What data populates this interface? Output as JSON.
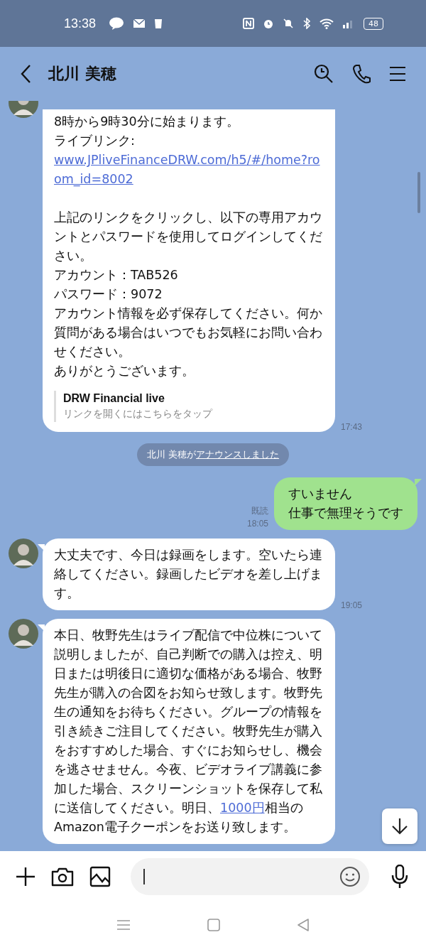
{
  "status_bar": {
    "time": "13:38",
    "battery": "48"
  },
  "header": {
    "title": "北川 美穂"
  },
  "messages": [
    {
      "kind": "incoming",
      "segments": [
        {
          "kind": "text",
          "text": "8時から9時30分に始まります。"
        },
        {
          "kind": "text",
          "text": "ライブリンク:"
        },
        {
          "kind": "url",
          "text": "www.JPliveFinanceDRW.com/h5/#/home?room_id=8002"
        },
        {
          "kind": "paragraph",
          "text": "上記のリンクをクリックし、以下の専用アカウントとパスワードを使用してログインしてください。"
        },
        {
          "kind": "text",
          "text": "アカウント：TAB526"
        },
        {
          "kind": "text",
          "text": "パスワード：9072"
        },
        {
          "kind": "text",
          "text": "アカウント情報を必ず保存してください。何か質問がある場合はいつでもお気軽にお問い合わせください。"
        },
        {
          "kind": "text",
          "text": "ありがとうございます。"
        }
      ],
      "preview": {
        "title": "DRW Financial live",
        "subtitle": "リンクを開くにはこちらをタップ"
      },
      "time": "17:43"
    },
    {
      "kind": "system",
      "text": "北川 美穂が",
      "link": "アナウンスしました"
    },
    {
      "kind": "outgoing",
      "segments": [
        {
          "kind": "text",
          "text": "すいません"
        },
        {
          "kind": "text",
          "text": "仕事で無理そうです"
        }
      ],
      "read": "既読",
      "time": "18:05"
    },
    {
      "kind": "incoming",
      "segments": [
        {
          "kind": "text",
          "text": "大丈夫です、今日は録画をします。空いたら連絡してください。録画したビデオを差し上げます。"
        }
      ],
      "time": "19:05"
    },
    {
      "kind": "incoming",
      "segments": [
        {
          "kind": "rich",
          "text": "本日、牧野先生はライブ配信で中位株について説明しましたが、自己判断での購入は控え、明日または明後日に適切な価格がある場合、牧野先生が購入の合図をお知らせ致します。牧野先生の通知をお待ちください。グループの情報を引き続きご注目してください。牧野先生が購入をおすすめした場合、すぐにお知らせし、機会を逃させません。今夜、ビデオライブ講義に参加した場合、スクリーンショットを保存して私に送信してください。明日、"
        },
        {
          "kind": "link",
          "text": "1000円"
        },
        {
          "kind": "rich",
          "text": "相当のAmazon電子クーポンをお送り致します。"
        }
      ]
    }
  ]
}
